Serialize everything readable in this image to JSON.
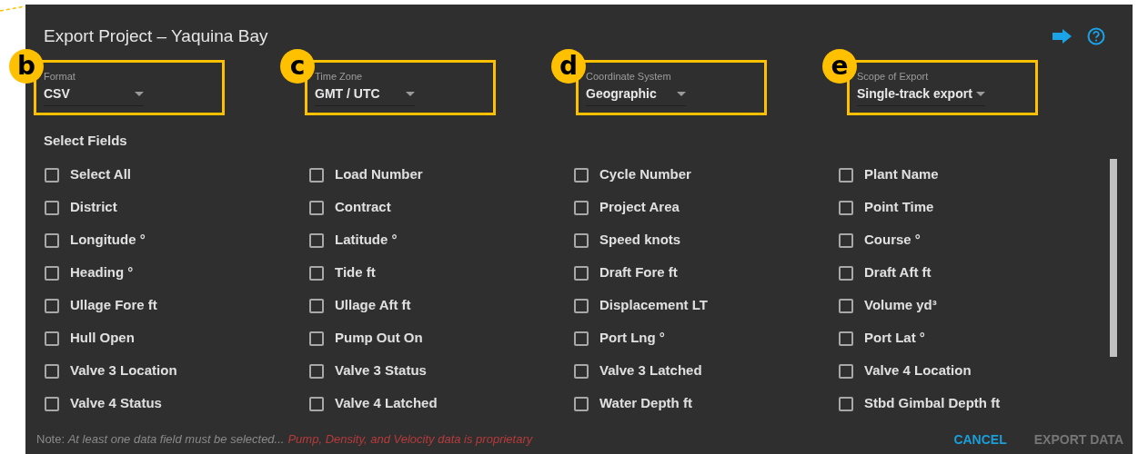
{
  "dialog": {
    "title": "Export Project – Yaquina Bay"
  },
  "selects": [
    {
      "callout": "b",
      "label": "Format",
      "value": "CSV"
    },
    {
      "callout": "c",
      "label": "Time Zone",
      "value": "GMT / UTC"
    },
    {
      "callout": "d",
      "label": "Coordinate System",
      "value": "Geographic"
    },
    {
      "callout": "e",
      "label": "Scope of Export",
      "value": "Single-track export"
    }
  ],
  "fields_heading": "Select Fields",
  "fields": [
    {
      "label": "Select All",
      "checked": false
    },
    {
      "label": "Load Number",
      "checked": false
    },
    {
      "label": "Cycle Number",
      "checked": false
    },
    {
      "label": "Plant Name",
      "checked": false
    },
    {
      "label": "District",
      "checked": false
    },
    {
      "label": "Contract",
      "checked": false
    },
    {
      "label": "Project Area",
      "checked": false
    },
    {
      "label": "Point Time",
      "checked": false
    },
    {
      "label": "Longitude °",
      "checked": false
    },
    {
      "label": "Latitude °",
      "checked": false
    },
    {
      "label": "Speed knots",
      "checked": false
    },
    {
      "label": "Course °",
      "checked": false
    },
    {
      "label": "Heading °",
      "checked": false
    },
    {
      "label": "Tide ft",
      "checked": false
    },
    {
      "label": "Draft Fore ft",
      "checked": false
    },
    {
      "label": "Draft Aft ft",
      "checked": false
    },
    {
      "label": "Ullage Fore ft",
      "checked": false
    },
    {
      "label": "Ullage Aft ft",
      "checked": false
    },
    {
      "label": "Displacement LT",
      "checked": false
    },
    {
      "label": "Volume yd³",
      "checked": false
    },
    {
      "label": "Hull Open",
      "checked": false
    },
    {
      "label": "Pump Out On",
      "checked": false
    },
    {
      "label": "Port Lng °",
      "checked": false
    },
    {
      "label": "Port Lat °",
      "checked": false
    },
    {
      "label": "Valve 3 Location",
      "checked": false
    },
    {
      "label": "Valve 3 Status",
      "checked": false
    },
    {
      "label": "Valve 3 Latched",
      "checked": false
    },
    {
      "label": "Valve 4 Location",
      "checked": false
    },
    {
      "label": "Valve 4 Status",
      "checked": false
    },
    {
      "label": "Valve 4 Latched",
      "checked": false
    },
    {
      "label": "Water Depth ft",
      "checked": false
    },
    {
      "label": "Stbd Gimbal Depth ft",
      "checked": false
    }
  ],
  "footer": {
    "note": "Note: *At least one data field must be selected...*",
    "warning": "Pump, Density, and Velocity data is proprietary",
    "buttons": [
      {
        "label": "CANCEL",
        "disabled": false
      },
      {
        "label": "EXPORT DATA",
        "disabled": true
      }
    ]
  }
}
